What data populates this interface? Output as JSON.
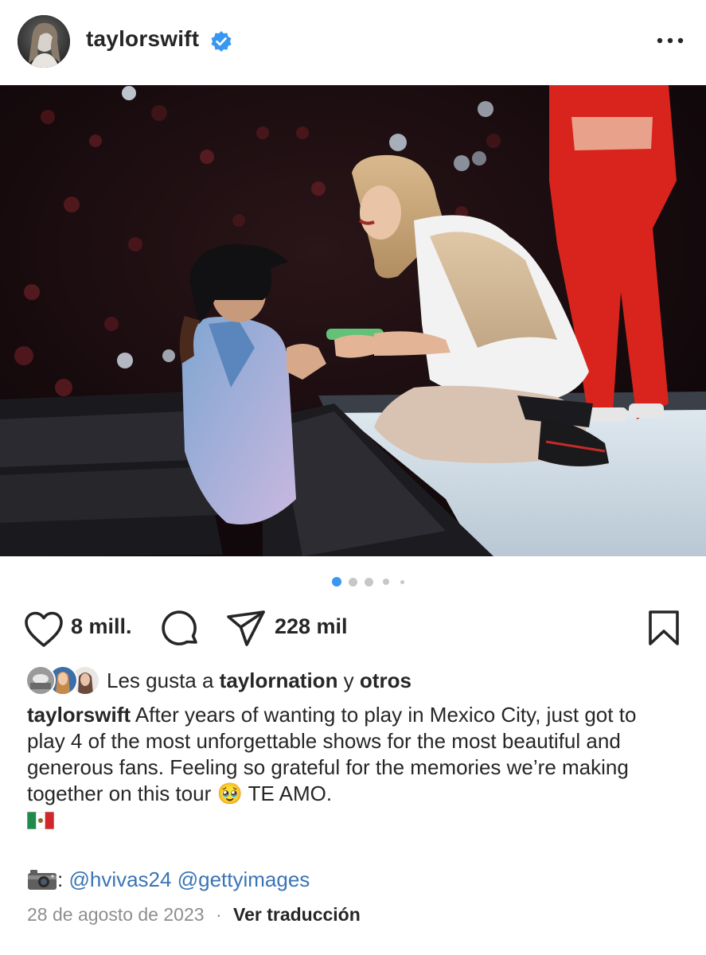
{
  "header": {
    "username": "taylorswift",
    "verified_icon": "verified-badge-icon",
    "more_icon": "more-options-icon"
  },
  "media": {
    "description_icon": "concert-photo",
    "carousel": {
      "total": 5,
      "active_index": 0
    }
  },
  "actions": {
    "like_count": "8 mill.",
    "share_count": "228 mil",
    "like_icon": "heart-icon",
    "comment_icon": "comment-icon",
    "share_icon": "paper-plane-icon",
    "save_icon": "bookmark-icon"
  },
  "liked_by": {
    "prefix": "Les gusta a ",
    "user": "taylornation",
    "joiner": " y ",
    "others": "otros"
  },
  "caption": {
    "author": "taylorswift",
    "text": "After years of wanting to play in Mexico City, just got to play 4 of the most unforgettable shows for the most beautiful and generous fans. Feeling so grateful for the memories we’re making together on this tour",
    "emoji": "🥹",
    "closing": "TE AMO."
  },
  "credit": {
    "separator": ":",
    "mention1": "@hvivas24",
    "mention2": "@gettyimages"
  },
  "footer": {
    "date": "28 de agosto de 2023",
    "dot": "·",
    "translate": "Ver traducción"
  },
  "colors": {
    "text": "#262626",
    "muted": "#8e8e8e",
    "link": "#3a74b5",
    "accent": "#3897f0"
  }
}
